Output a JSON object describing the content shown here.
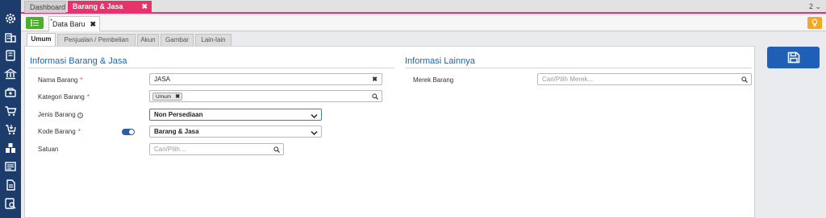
{
  "top_tabs": [
    {
      "label": "Dashboard"
    },
    {
      "label": "Barang & Jasa",
      "close": "✖"
    }
  ],
  "window_count": "2 ⌄",
  "doc_tab": {
    "label": "Data Baru",
    "marker": "*",
    "close": "✖"
  },
  "sub_tabs": [
    {
      "label": "Umum"
    },
    {
      "label": "Penjualan / Pembelian"
    },
    {
      "label": "Akun"
    },
    {
      "label": "Gambar"
    },
    {
      "label": "Lain-lain"
    }
  ],
  "section_left": {
    "title": "Informasi Barang & Jasa",
    "nama_barang": {
      "label": "Nama Barang",
      "required": "*",
      "value": "JASA",
      "clear": "✖"
    },
    "kategori_barang": {
      "label": "Kategori Barang",
      "required": "*",
      "chip": "Umum",
      "chip_close": "✖"
    },
    "jenis_barang": {
      "label": "Jenis Barang",
      "info": "i",
      "value": "Non Persediaan"
    },
    "kode_barang": {
      "label": "Kode Barang",
      "required": "*",
      "value": "Barang & Jasa"
    },
    "satuan": {
      "label": "Satuan",
      "placeholder": "Cari/Pilih..."
    }
  },
  "section_right": {
    "title": "Informasi Lainnya",
    "merek_barang": {
      "label": "Merek Barang",
      "placeholder": "Cari/Pilih Merek..."
    }
  },
  "colors": {
    "rail": "#1c3d6b",
    "accent_pink": "#e7336b",
    "save_blue": "#1f5fb6",
    "menu_green": "#4caf2a",
    "bulb_orange": "#f7a823",
    "section_title": "#1c65a9"
  },
  "rail_icons": [
    "settings-icon",
    "company-icon",
    "book-icon",
    "bank-icon",
    "sales-icon",
    "cart-icon",
    "purchase-icon",
    "inventory-icon",
    "report-icon",
    "truck-icon",
    "document-icon",
    "search-report-icon"
  ]
}
